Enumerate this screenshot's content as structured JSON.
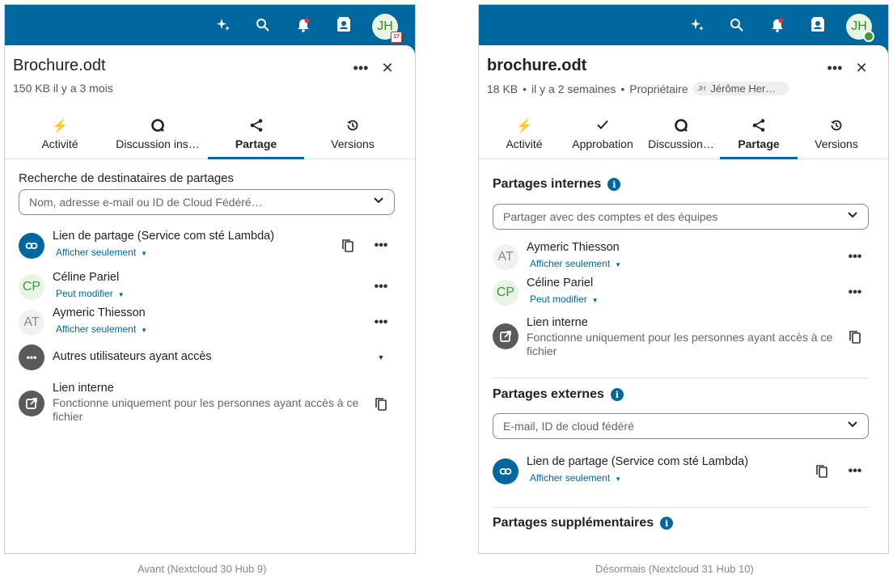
{
  "before": {
    "file_title": "Brochure.odt",
    "meta": "150 KB il y a 3 mois",
    "avatar_initials": "JH",
    "calendar_badge": "17",
    "tabs": [
      {
        "label": "Activité",
        "icon": "⚡"
      },
      {
        "label": "Discussion ins…",
        "icon": "discussion-icon"
      },
      {
        "label": "Partage",
        "icon": "share-icon"
      },
      {
        "label": "Versions",
        "icon": "history-icon"
      }
    ],
    "search_label": "Recherche de destinataires de partages",
    "search_placeholder": "Nom, adresse e-mail ou ID de Cloud Fédéré…",
    "shares": {
      "link": {
        "name": "Lien de partage (Service com sté Lambda)",
        "perm": "Afficher seulement"
      },
      "celine": {
        "initials": "CP",
        "name": "Céline Pariel",
        "perm": "Peut modifier"
      },
      "aymeric": {
        "initials": "AT",
        "name": "Aymeric Thiesson",
        "perm": "Afficher seulement"
      },
      "others": {
        "name": "Autres utilisateurs ayant accès"
      },
      "internal": {
        "name": "Lien interne",
        "desc": "Fonctionne uniquement pour les personnes ayant accès à ce fichier"
      }
    },
    "caption": "Avant (Nextcloud 30 Hub 9)"
  },
  "after": {
    "file_title": "brochure.odt",
    "meta_size": "18 KB",
    "meta_time": "il y a 2 semaines",
    "meta_owner": "Propriétaire",
    "owner_initials": "JH",
    "owner_name": "Jérôme Her…",
    "avatar_initials": "JH",
    "tabs": [
      {
        "label": "Activité",
        "icon": "⚡"
      },
      {
        "label": "Approbation",
        "icon": "✓"
      },
      {
        "label": "Discussion…",
        "icon": "discussion-icon"
      },
      {
        "label": "Partage",
        "icon": "share-icon"
      },
      {
        "label": "Versions",
        "icon": "history-icon"
      }
    ],
    "internal_heading": "Partages internes",
    "internal_placeholder": "Partager avec des comptes et des équipes",
    "shares": {
      "aymeric": {
        "initials": "AT",
        "name": "Aymeric Thiesson",
        "perm": "Afficher seulement"
      },
      "celine": {
        "initials": "CP",
        "name": "Céline Pariel",
        "perm": "Peut modifier"
      },
      "internal": {
        "name": "Lien interne",
        "desc": "Fonctionne uniquement pour les personnes ayant accès à ce fichier"
      },
      "link": {
        "name": "Lien de partage (Service com sté Lambda)",
        "perm": "Afficher seulement"
      }
    },
    "external_heading": "Partages externes",
    "external_placeholder": "E-mail, ID de cloud fédéré",
    "additional_heading": "Partages supplémentaires",
    "caption": "Désormais (Nextcloud 31 Hub 10)"
  },
  "colors": {
    "brand": "#00679e",
    "accent_green": "#3a9a3a",
    "notification": "#e9322d"
  }
}
